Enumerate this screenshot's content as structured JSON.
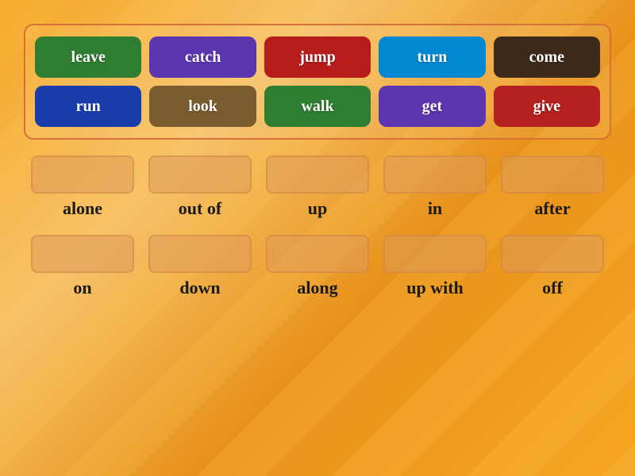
{
  "wordCards": {
    "row1": [
      {
        "label": "leave",
        "color": "#2e7d32"
      },
      {
        "label": "catch",
        "color": "#5c35b0"
      },
      {
        "label": "jump",
        "color": "#b71c1c"
      },
      {
        "label": "turn",
        "color": "#0288d1"
      },
      {
        "label": "come",
        "color": "#3e2a1a"
      }
    ],
    "row2": [
      {
        "label": "run",
        "color": "#1a3dab"
      },
      {
        "label": "look",
        "color": "#7a5c2e"
      },
      {
        "label": "walk",
        "color": "#2e7d32"
      },
      {
        "label": "get",
        "color": "#5c35b0"
      },
      {
        "label": "give",
        "color": "#b52020"
      }
    ]
  },
  "dropRows": {
    "row1": [
      {
        "label": "alone"
      },
      {
        "label": "out of"
      },
      {
        "label": "up"
      },
      {
        "label": "in"
      },
      {
        "label": "after"
      }
    ],
    "row2": [
      {
        "label": "on"
      },
      {
        "label": "down"
      },
      {
        "label": "along"
      },
      {
        "label": "up with"
      },
      {
        "label": "off"
      }
    ]
  }
}
